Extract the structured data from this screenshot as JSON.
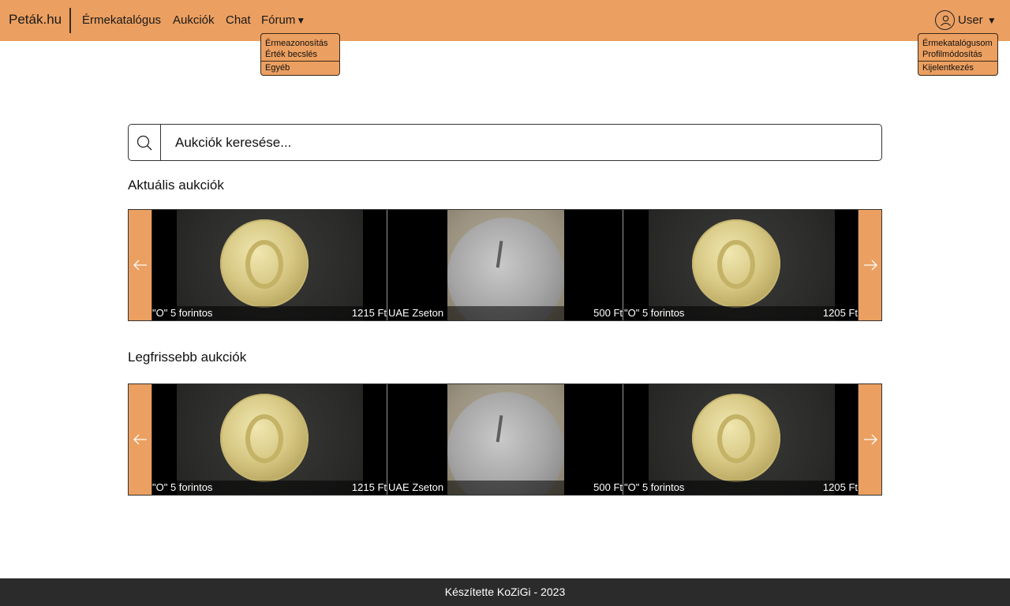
{
  "nav": {
    "brand": "Peták.hu",
    "links": [
      "Érmekatalógus",
      "Aukciók",
      "Chat"
    ],
    "forum_label": "Fórum",
    "forum_caret": "▼",
    "forum_menu": {
      "group1": [
        "Érmeazonosítás",
        "Érték becslés"
      ],
      "group2": [
        "Egyéb"
      ]
    },
    "user_label": "User",
    "user_caret": "▼",
    "user_menu": {
      "group1": [
        "Érmekatalógusom",
        "Profilmódosítás"
      ],
      "group2": [
        "Kijelentkezés"
      ]
    }
  },
  "search": {
    "placeholder": "Aukciók keresése..."
  },
  "sections": [
    {
      "title": "Aktuális aukciók",
      "items": [
        {
          "name": "\"O\" 5 forintos",
          "price": "1215 Ft",
          "coin": "gold"
        },
        {
          "name": "UAE Zseton",
          "price": "500 Ft",
          "coin": "silver"
        },
        {
          "name": "\"O\" 5 forintos",
          "price": "1205 Ft",
          "coin": "gold"
        }
      ]
    },
    {
      "title": "Legfrissebb aukciók",
      "items": [
        {
          "name": "\"O\" 5 forintos",
          "price": "1215 Ft",
          "coin": "gold"
        },
        {
          "name": "UAE Zseton",
          "price": "500 Ft",
          "coin": "silver"
        },
        {
          "name": "\"O\" 5 forintos",
          "price": "1205 Ft",
          "coin": "gold"
        }
      ]
    }
  ],
  "footer": {
    "text": "Készítette KoZiGi - 2023"
  },
  "icons": {
    "search": "search-icon",
    "user": "user-circle-icon",
    "prev": "arrow-left-icon",
    "next": "arrow-right-icon"
  },
  "colors": {
    "accent": "#eb9f60",
    "footer": "#2b2b2b"
  }
}
